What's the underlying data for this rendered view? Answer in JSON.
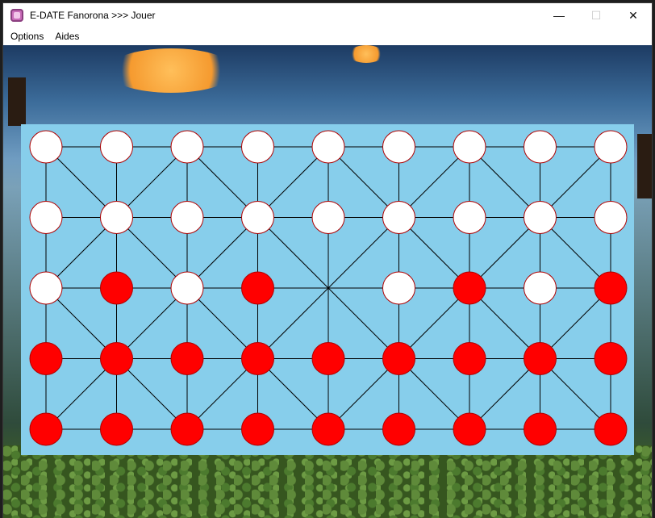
{
  "window": {
    "title": "E-DATE Fanorona >>> Jouer",
    "minimize_glyph": "—",
    "maximize_glyph": "☐",
    "close_glyph": "✕"
  },
  "menu": {
    "items": [
      "Options",
      "Aides"
    ]
  },
  "colors": {
    "board_background": "#87ceeb",
    "line": "#000000",
    "white_piece": "#ffffff",
    "red_piece": "#ff0000",
    "piece_outline": "#b00000"
  },
  "icons": {
    "app": "fanorona-app-icon",
    "minimize": "minimize-icon",
    "maximize": "maximize-icon",
    "close": "close-icon"
  },
  "board": {
    "columns": 9,
    "rows": 5,
    "cells": [
      [
        "white",
        "white",
        "white",
        "white",
        "white",
        "white",
        "white",
        "white",
        "white"
      ],
      [
        "white",
        "white",
        "white",
        "white",
        "white",
        "white",
        "white",
        "white",
        "white"
      ],
      [
        "white",
        "red",
        "white",
        "red",
        "empty",
        "white",
        "red",
        "white",
        "red"
      ],
      [
        "red",
        "red",
        "red",
        "red",
        "red",
        "red",
        "red",
        "red",
        "red"
      ],
      [
        "red",
        "red",
        "red",
        "red",
        "red",
        "red",
        "red",
        "red",
        "red"
      ]
    ]
  }
}
